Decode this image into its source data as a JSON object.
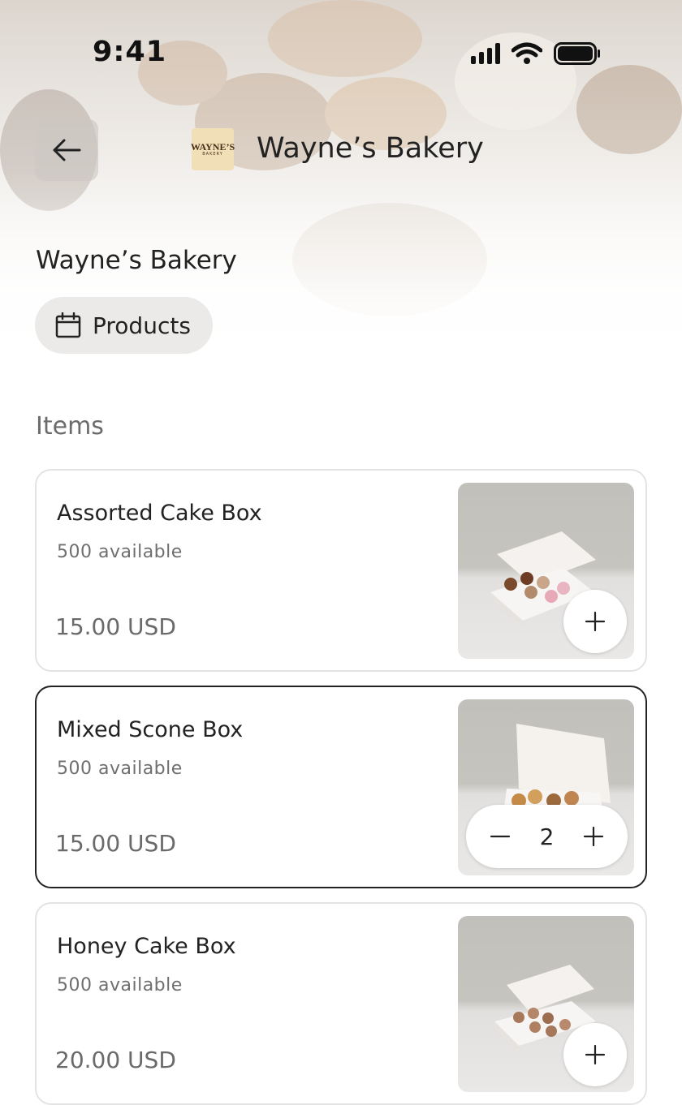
{
  "status_bar": {
    "time": "9:41"
  },
  "header": {
    "title": "Wayne’s Bakery",
    "logo_text": "WAYNE’S",
    "logo_subtext": "BAKERY"
  },
  "store": {
    "name": "Wayne’s Bakery",
    "chip_label": "Products",
    "chip_icon": "calendar-icon"
  },
  "items_section": {
    "title": "Items"
  },
  "items": [
    {
      "name": "Assorted Cake Box",
      "availability": "500 available",
      "price": "15.00 USD",
      "action": "add"
    },
    {
      "name": "Mixed Scone Box",
      "availability": "500 available",
      "price": "15.00 USD",
      "quantity": "2",
      "action": "stepper"
    },
    {
      "name": "Honey Cake Box",
      "availability": "500 available",
      "price": "20.00 USD",
      "action": "add"
    }
  ],
  "colors": {
    "text": "#222222",
    "muted": "#6b6b6b",
    "selected_border": "#222222",
    "card_border": "#e3e3e3"
  }
}
